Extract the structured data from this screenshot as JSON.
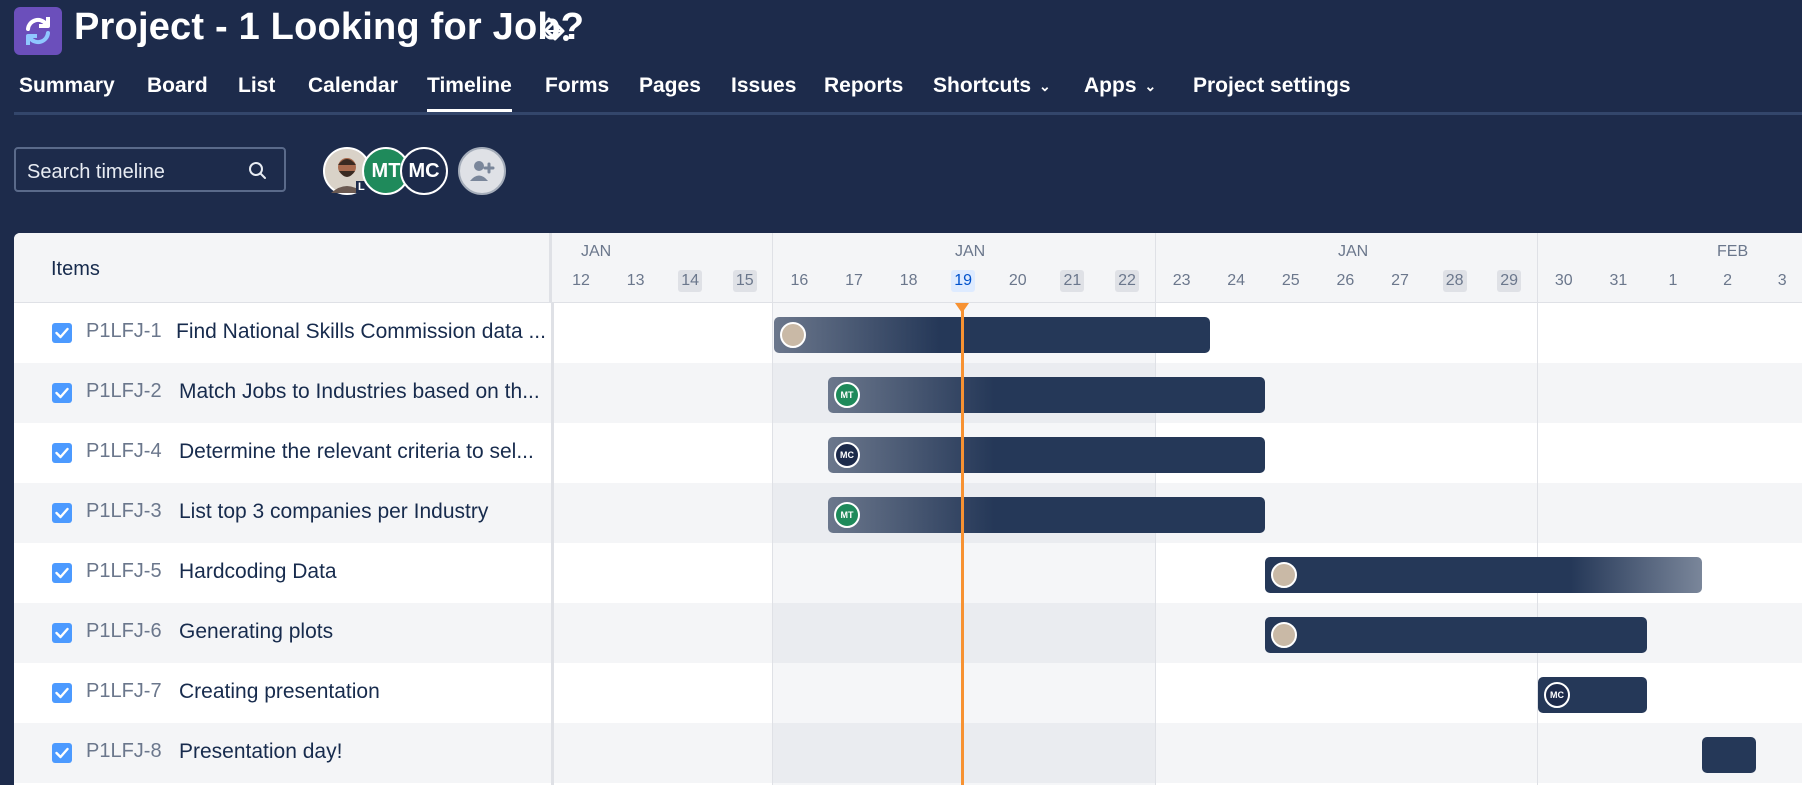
{
  "project": {
    "title": "Project - 1 Looking for Job?"
  },
  "tabs": [
    {
      "label": "Summary"
    },
    {
      "label": "Board"
    },
    {
      "label": "List"
    },
    {
      "label": "Calendar"
    },
    {
      "label": "Timeline",
      "active": true
    },
    {
      "label": "Forms"
    },
    {
      "label": "Pages"
    },
    {
      "label": "Issues"
    },
    {
      "label": "Reports"
    },
    {
      "label": "Shortcuts",
      "dropdown": true
    },
    {
      "label": "Apps",
      "dropdown": true
    },
    {
      "label": "Project settings"
    }
  ],
  "toolbar": {
    "search_placeholder": "Search timeline",
    "avatars": [
      {
        "type": "photo",
        "badge": "L"
      },
      {
        "initials": "MT",
        "color": "#1f8a5b"
      },
      {
        "initials": "MC",
        "color": "#1d2b4b"
      }
    ]
  },
  "timeline": {
    "items_header": "Items",
    "months": [
      {
        "label": "JAN"
      },
      {
        "label": "JAN"
      },
      {
        "label": "JAN"
      },
      {
        "label": "FEB"
      }
    ],
    "days": [
      "12",
      "13",
      "14",
      "15",
      "16",
      "17",
      "18",
      "19",
      "20",
      "21",
      "22",
      "23",
      "24",
      "25",
      "26",
      "27",
      "28",
      "29",
      "30",
      "31",
      "1",
      "2",
      "3"
    ],
    "weekend_days": [
      "14",
      "15",
      "21",
      "22",
      "28",
      "29"
    ],
    "today": "19",
    "items": [
      {
        "key": "P1LFJ-1",
        "summary": "Find National Skills Commission data ...",
        "assignee": "photo",
        "done": true
      },
      {
        "key": "P1LFJ-2",
        "summary": "Match Jobs to Industries based on th...",
        "assignee": "MT",
        "done": true
      },
      {
        "key": "P1LFJ-4",
        "summary": "Determine the relevant criteria to sel...",
        "assignee": "MC",
        "done": true
      },
      {
        "key": "P1LFJ-3",
        "summary": "List top 3 companies per Industry",
        "assignee": "MT",
        "done": true
      },
      {
        "key": "P1LFJ-5",
        "summary": "Hardcoding Data",
        "assignee": "photo",
        "done": true
      },
      {
        "key": "P1LFJ-6",
        "summary": "Generating plots",
        "assignee": "photo",
        "done": true
      },
      {
        "key": "P1LFJ-7",
        "summary": "Creating presentation",
        "assignee": "MC",
        "done": true
      },
      {
        "key": "P1LFJ-8",
        "summary": "Presentation day!",
        "assignee": "",
        "done": true
      }
    ]
  }
}
